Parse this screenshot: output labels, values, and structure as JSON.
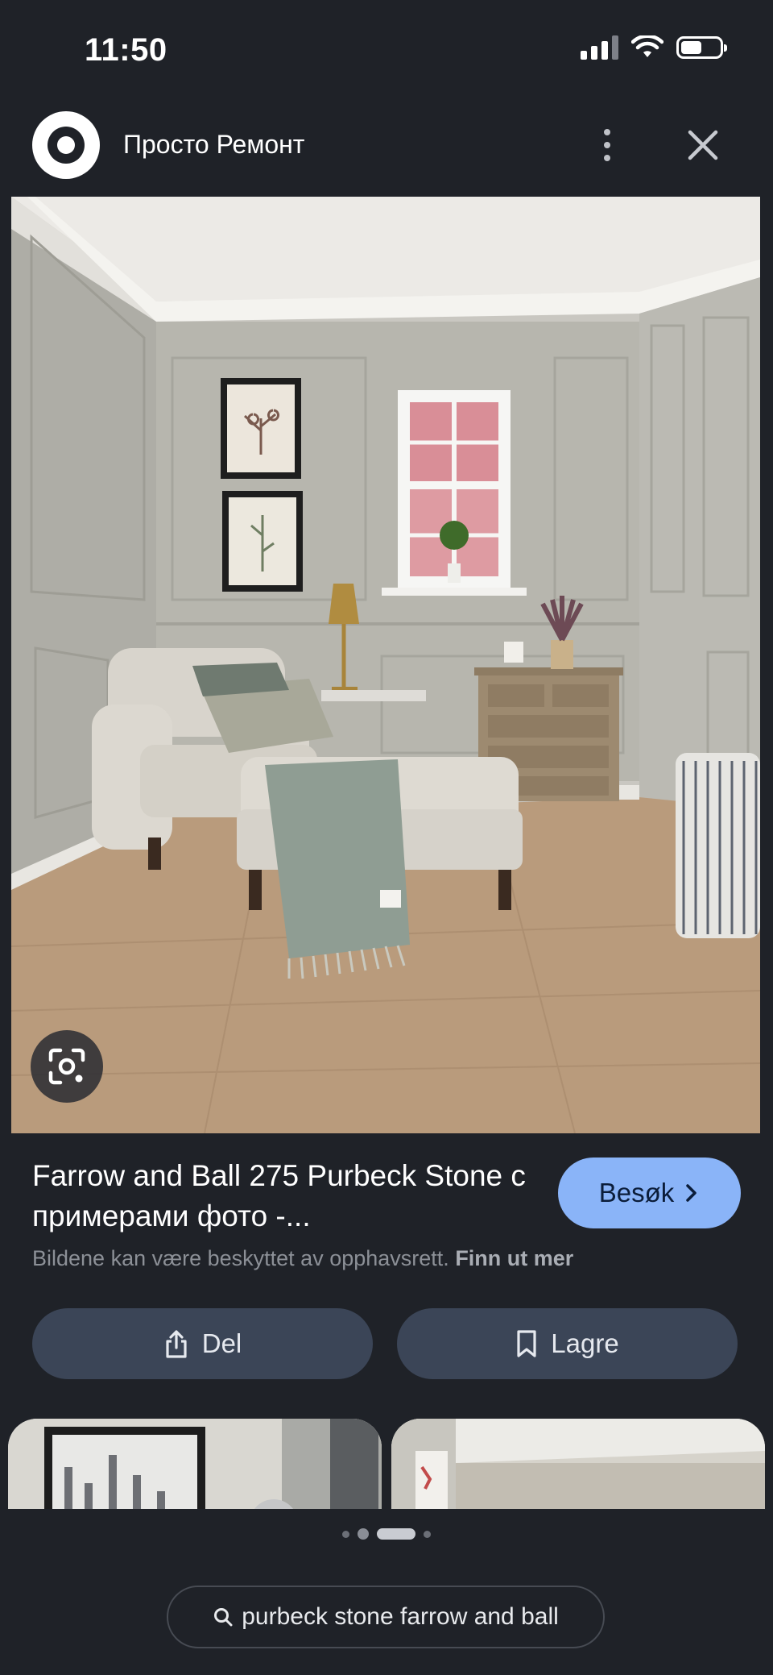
{
  "status_bar": {
    "time": "11:50",
    "battery_level": 0.6
  },
  "header": {
    "site_name": "Просто Ремонт",
    "more_icon": "more-vert-icon",
    "close_icon": "close-icon"
  },
  "image": {
    "description_icon": "google-lens-icon",
    "colors": {
      "wall": "#b4b3ac",
      "ceiling": "#ebebe8",
      "floor": "#b8997a",
      "chair": "#dcd8d0",
      "throw": "#8e9c92",
      "dresser": "#9c8a72"
    }
  },
  "result": {
    "title": "Farrow and Ball 275 Purbeck Stone с примерами фото -...",
    "visit_label": "Besøk",
    "copyright_notice": "Bildene kan være beskyttet av opphavsrett.",
    "learn_more": "Finn ut mer"
  },
  "actions": {
    "share_label": "Del",
    "save_label": "Lagre"
  },
  "pagination": {
    "count": 4,
    "active_index": 2
  },
  "search_query": "purbeck stone farrow and ball",
  "accent_color": "#8ab4f8"
}
